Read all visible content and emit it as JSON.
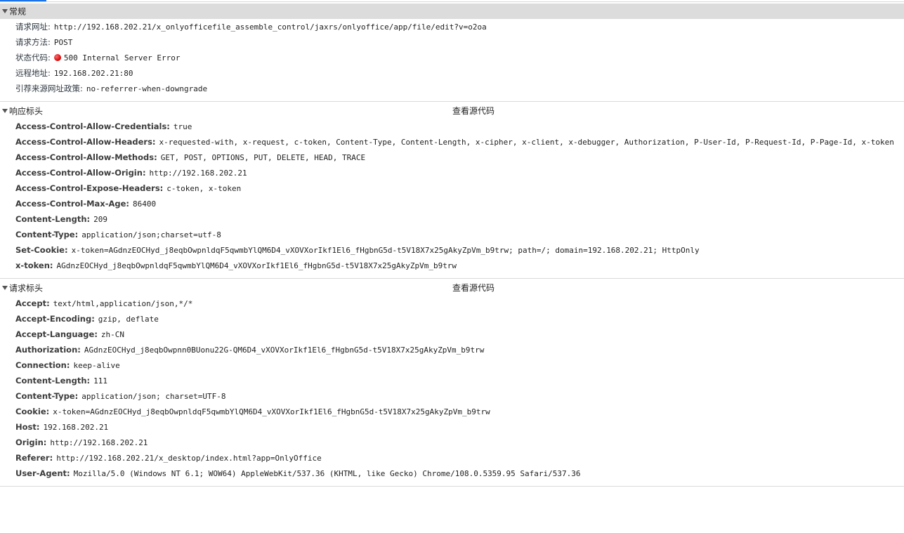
{
  "general": {
    "title": "常规",
    "rows": [
      {
        "key": "请求网址:",
        "value": "http://192.168.202.21/x_onlyofficefile_assemble_control/jaxrs/onlyoffice/app/file/edit?v=o2oa"
      },
      {
        "key": "请求方法:",
        "value": "POST"
      },
      {
        "key": "状态代码:",
        "value": "500 Internal Server Error",
        "status_color": "#d20000"
      },
      {
        "key": "远程地址:",
        "value": "192.168.202.21:80"
      },
      {
        "key": "引荐来源网址政策:",
        "value": "no-referrer-when-downgrade"
      }
    ]
  },
  "response_headers": {
    "title": "响应标头",
    "view_source": "查看源代码",
    "rows": [
      {
        "key": "Access-Control-Allow-Credentials:",
        "value": "true"
      },
      {
        "key": "Access-Control-Allow-Headers:",
        "value": "x-requested-with, x-request, c-token, Content-Type, Content-Length, x-cipher, x-client, x-debugger, Authorization, P-User-Id, P-Request-Id, P-Page-Id, x-token"
      },
      {
        "key": "Access-Control-Allow-Methods:",
        "value": "GET, POST, OPTIONS, PUT, DELETE, HEAD, TRACE"
      },
      {
        "key": "Access-Control-Allow-Origin:",
        "value": "http://192.168.202.21"
      },
      {
        "key": "Access-Control-Expose-Headers:",
        "value": "c-token, x-token"
      },
      {
        "key": "Access-Control-Max-Age:",
        "value": "86400"
      },
      {
        "key": "Content-Length:",
        "value": "209"
      },
      {
        "key": "Content-Type:",
        "value": "application/json;charset=utf-8"
      },
      {
        "key": "Set-Cookie:",
        "value": "x-token=AGdnzEOCHyd_j8eqbOwpnldqF5qwmbYlQM6D4_vXOVXorIkf1El6_fHgbnG5d-t5V18X7x25gAkyZpVm_b9trw; path=/; domain=192.168.202.21; HttpOnly"
      },
      {
        "key": "x-token:",
        "value": "AGdnzEOCHyd_j8eqbOwpnldqF5qwmbYlQM6D4_vXOVXorIkf1El6_fHgbnG5d-t5V18X7x25gAkyZpVm_b9trw"
      }
    ]
  },
  "request_headers": {
    "title": "请求标头",
    "view_source": "查看源代码",
    "rows": [
      {
        "key": "Accept:",
        "value": "text/html,application/json,*/*"
      },
      {
        "key": "Accept-Encoding:",
        "value": "gzip, deflate"
      },
      {
        "key": "Accept-Language:",
        "value": "zh-CN"
      },
      {
        "key": "Authorization:",
        "value": "AGdnzEOCHyd_j8eqbOwpnn0BUonu22G-QM6D4_vXOVXorIkf1El6_fHgbnG5d-t5V18X7x25gAkyZpVm_b9trw"
      },
      {
        "key": "Connection:",
        "value": "keep-alive"
      },
      {
        "key": "Content-Length:",
        "value": "111"
      },
      {
        "key": "Content-Type:",
        "value": "application/json; charset=UTF-8"
      },
      {
        "key": "Cookie:",
        "value": "x-token=AGdnzEOCHyd_j8eqbOwpnldqF5qwmbYlQM6D4_vXOVXorIkf1El6_fHgbnG5d-t5V18X7x25gAkyZpVm_b9trw"
      },
      {
        "key": "Host:",
        "value": "192.168.202.21"
      },
      {
        "key": "Origin:",
        "value": "http://192.168.202.21"
      },
      {
        "key": "Referer:",
        "value": "http://192.168.202.21/x_desktop/index.html?app=OnlyOffice"
      },
      {
        "key": "User-Agent:",
        "value": "Mozilla/5.0 (Windows NT 6.1; WOW64) AppleWebKit/537.36 (KHTML, like Gecko) Chrome/108.0.5359.95 Safari/537.36"
      }
    ]
  }
}
